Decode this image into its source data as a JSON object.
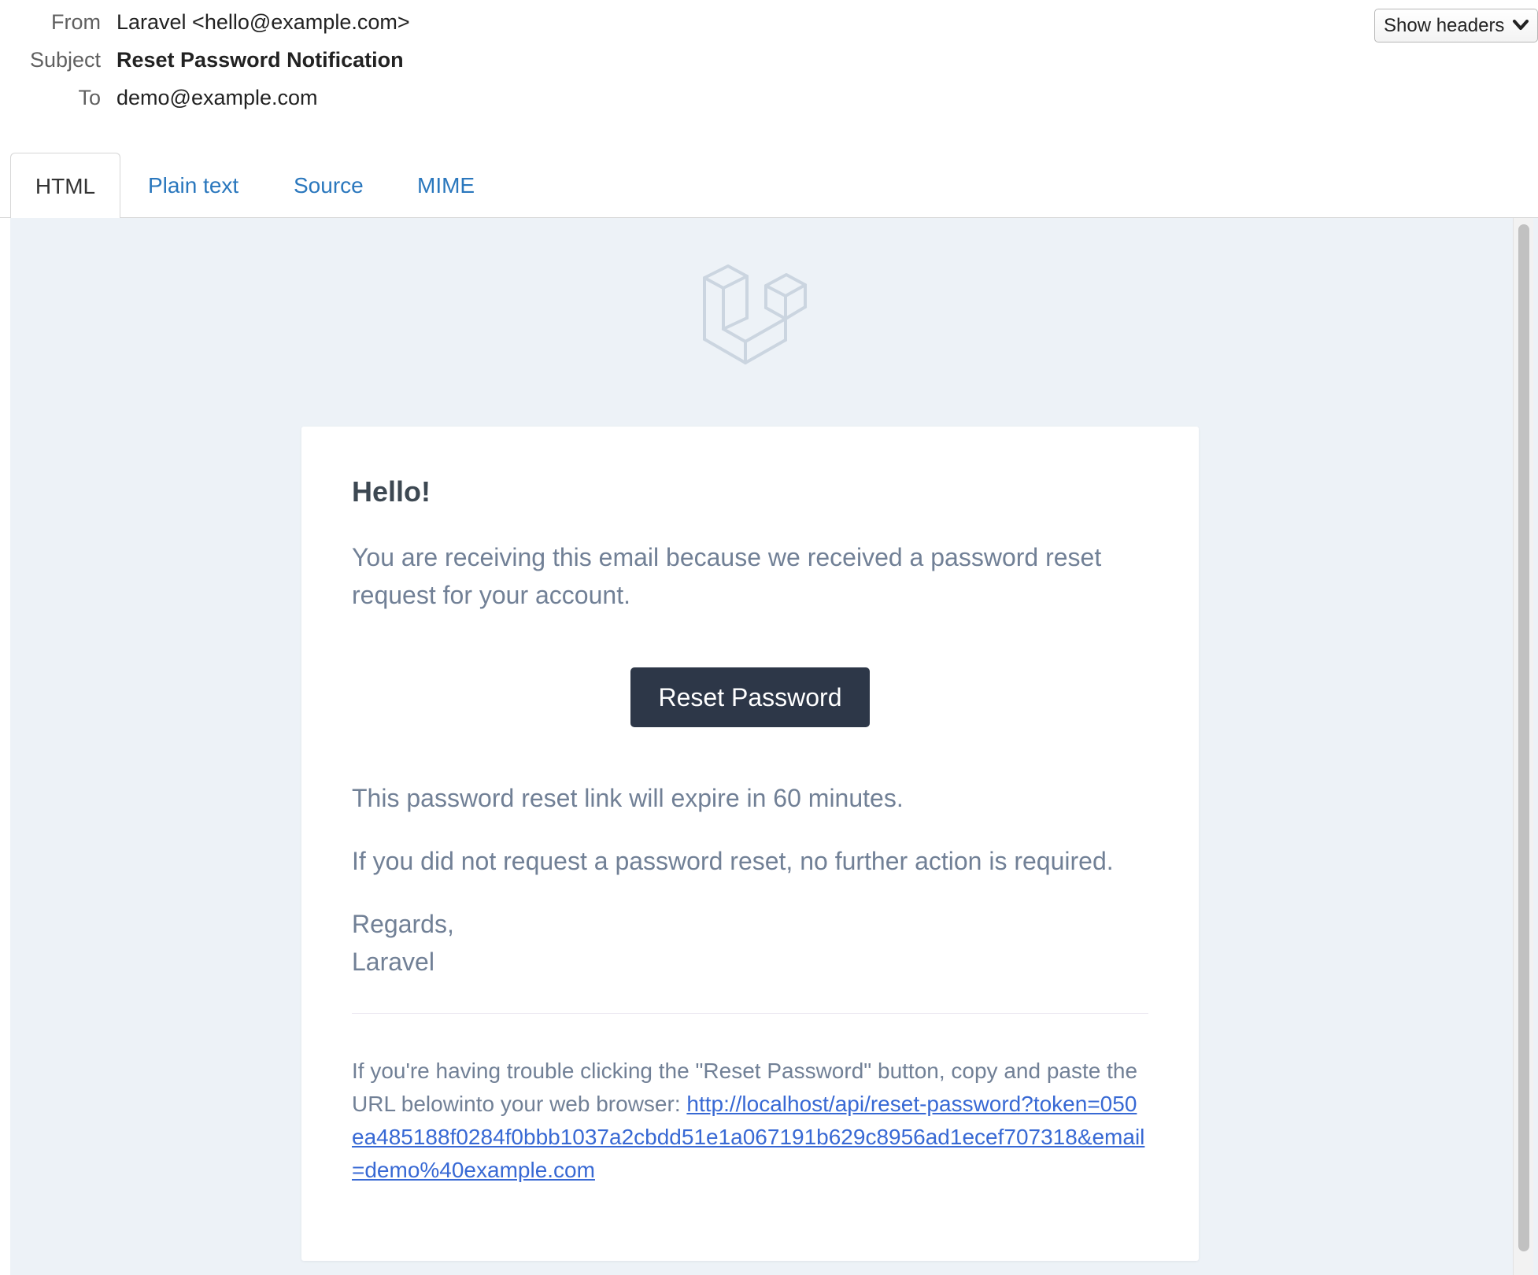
{
  "headers": {
    "from_label": "From",
    "from_value": "Laravel <hello@example.com>",
    "subject_label": "Subject",
    "subject_value": "Reset Password Notification",
    "to_label": "To",
    "to_value": "demo@example.com",
    "show_headers_label": "Show headers",
    "show_headers_icon": "chevron-down-icon"
  },
  "tabs": [
    {
      "label": "HTML",
      "active": true
    },
    {
      "label": "Plain text",
      "active": false
    },
    {
      "label": "Source",
      "active": false
    },
    {
      "label": "MIME",
      "active": false
    }
  ],
  "email": {
    "logo_icon": "laravel-logo",
    "logo_color": "#cbd5e0",
    "greeting": "Hello!",
    "intro": "You are receiving this email because we received a password reset request for your account.",
    "button_label": "Reset Password",
    "button_color": "#2d3748",
    "expiry": "This password reset link will expire in 60 minutes.",
    "no_action": "If you did not request a password reset, no further action is required.",
    "regards": "Regards,",
    "signature": "Laravel",
    "subcopy_text": "If you're having trouble clicking the \"Reset Password\" button, copy and paste the URL belowinto your web browser: ",
    "reset_url": "http://localhost/api/reset-password?token=050ea485188f0284f0bbb1037a2cbdd51e1a067191b629c8956ad1ecef707318&email=demo%40example.com",
    "link_color": "#3869d4"
  }
}
